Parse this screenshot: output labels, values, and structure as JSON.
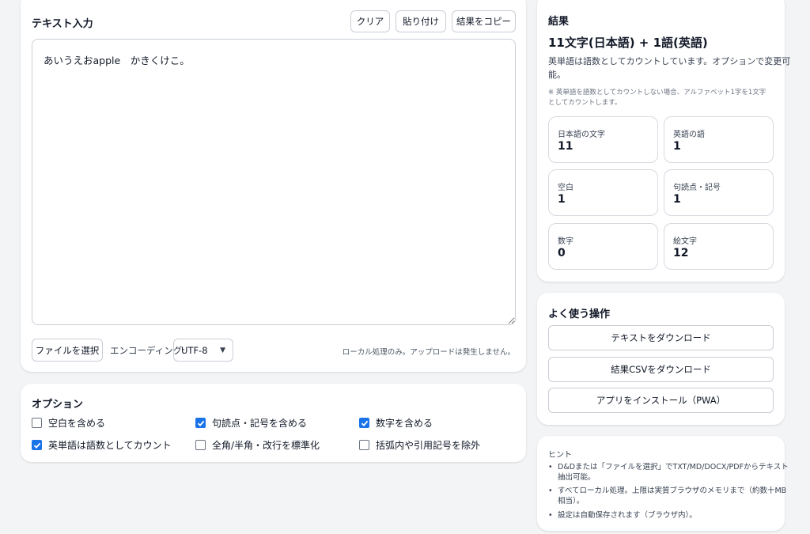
{
  "input": {
    "title": "テキスト入力",
    "clear_label": "クリア",
    "paste_label": "貼り付け",
    "copy_label": "結果をコピー",
    "text": "あいうえおapple　かきくけこ。",
    "file_button_label": "ファイルを選択",
    "encoding_label": "エンコーディング:",
    "encoding_value": "UTF-8",
    "local_note": "ローカル処理のみ。アップロードは発生しません。"
  },
  "options": {
    "title": "オプション",
    "items": [
      {
        "label": "空白を含める",
        "checked": false
      },
      {
        "label": "句読点・記号を含める",
        "checked": true
      },
      {
        "label": "数字を含める",
        "checked": true
      },
      {
        "label": "英単語は語数としてカウント",
        "checked": true
      },
      {
        "label": "全角/半角・改行を標準化",
        "checked": false
      },
      {
        "label": "括弧内や引用記号を除外",
        "checked": false
      }
    ]
  },
  "result": {
    "title": "結果",
    "headline": "11文字(日本語) + 1語(英語)",
    "desc_line1": "英単語は語数としてカウントしています。オプションで変更可",
    "desc_line2": "能。",
    "note_line1": "※ 英単語を語数としてカウントしない場合、アルファベット1字を1文字",
    "note_line2": "としてカウントします。",
    "stats": [
      {
        "label": "日本語の文字",
        "value": "11"
      },
      {
        "label": "英語の語",
        "value": "1"
      },
      {
        "label": "空白",
        "value": "1"
      },
      {
        "label": "句読点・記号",
        "value": "1"
      },
      {
        "label": "数字",
        "value": "0"
      },
      {
        "label": "絵文字",
        "value": "12"
      }
    ]
  },
  "actions": {
    "title": "よく使う操作",
    "download_text": "テキストをダウンロード",
    "download_csv": "結果CSVをダウンロード",
    "install_pwa": "アプリをインストール（PWA）"
  },
  "hints": {
    "title": "ヒント",
    "item1_line1": "D&Dまたは「ファイルを選択」でTXT/MD/DOCX/PDFからテキスト",
    "item1_line2": "抽出可能。",
    "item2_line1": "すべてローカル処理。上限は実質ブラウザのメモリまで（約数十MB",
    "item2_line2": "相当）。",
    "item3": "設定は自動保存されます（ブラウザ内）。"
  },
  "colors": {
    "accent": "#1a73e8",
    "border": "#c9ced6",
    "background": "#f3f4f6"
  }
}
